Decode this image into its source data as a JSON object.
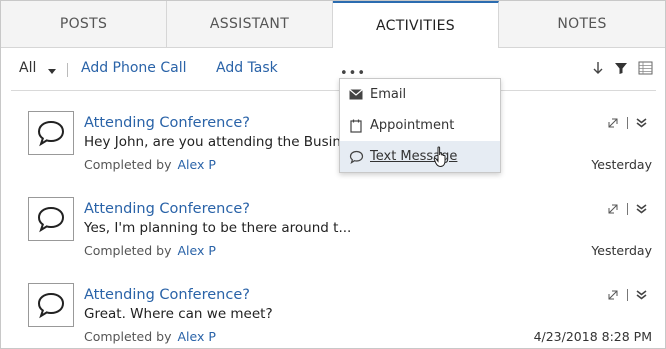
{
  "tabs": [
    {
      "label": "POSTS",
      "active": false
    },
    {
      "label": "ASSISTANT",
      "active": false
    },
    {
      "label": "ACTIVITIES",
      "active": true
    },
    {
      "label": "NOTES",
      "active": false
    }
  ],
  "toolbar": {
    "filter_label": "All",
    "add_phone_call": "Add Phone Call",
    "add_task": "Add Task",
    "more_label": "•••"
  },
  "menu": {
    "items": [
      {
        "label": "Email",
        "icon": "envelope-icon"
      },
      {
        "label": "Appointment",
        "icon": "calendar-icon"
      },
      {
        "label": "Text Message",
        "icon": "chat-bubble-icon"
      }
    ]
  },
  "activities": [
    {
      "title": "Attending Conference?",
      "body": "Hey John, are you attending the Busin...",
      "completed_by_label": "Completed by",
      "completed_by": "Alex P",
      "date": "Yesterday"
    },
    {
      "title": "Attending Conference?",
      "body": "Yes, I'm planning to be there around t...",
      "completed_by_label": "Completed by",
      "completed_by": "Alex P",
      "date": "Yesterday"
    },
    {
      "title": "Attending Conference?",
      "body": "Great. Where can we meet?",
      "completed_by_label": "Completed by",
      "completed_by": "Alex P",
      "date": "4/23/2018 8:28 PM"
    }
  ],
  "colors": {
    "accent": "#2b6cb0",
    "link": "#2a63a8",
    "menu_hover": "#e6ecf3"
  }
}
